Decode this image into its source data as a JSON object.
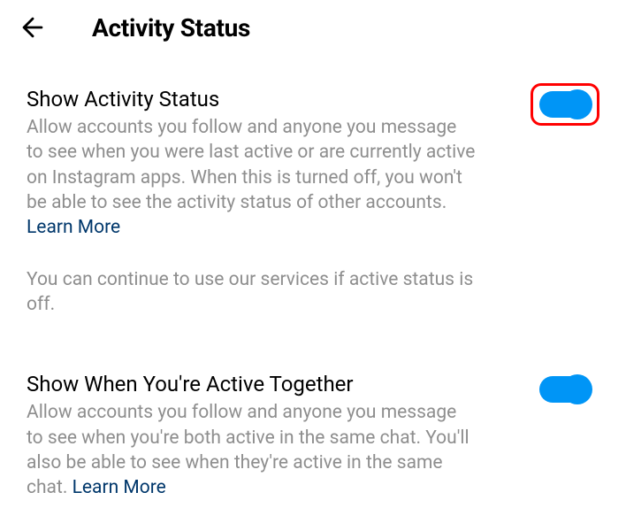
{
  "header": {
    "title": "Activity Status"
  },
  "sections": [
    {
      "title": "Show Activity Status",
      "description": "Allow accounts you follow and anyone you message to see when you were last active or are currently active on Instagram apps. When this is turned off, you won't be able to see the activity status of other accounts. ",
      "learnMore": "Learn More",
      "toggle": true,
      "highlighted": true,
      "secondaryNote": "You can continue to use our services if active status is off."
    },
    {
      "title": "Show When You're Active Together",
      "description": "Allow accounts you follow and anyone you message to see when you're both active in the same chat. You'll also be able to see when they're active in the same chat. ",
      "learnMore": "Learn More",
      "toggle": true,
      "highlighted": false
    }
  ],
  "colors": {
    "accent": "#0095f6",
    "linkDark": "#00376b",
    "muted": "#8e8e8e",
    "highlight": "#ff0000"
  }
}
